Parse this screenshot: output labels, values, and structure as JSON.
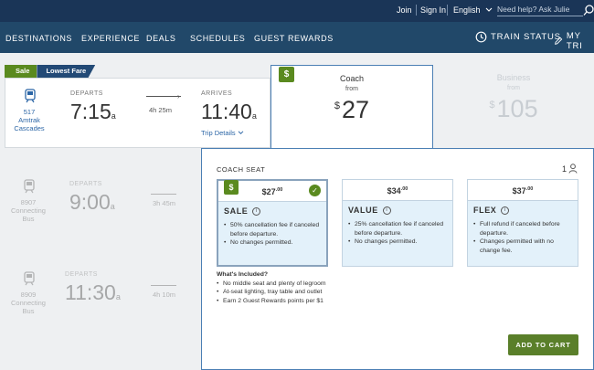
{
  "topbar": {
    "join": "Join",
    "sign_in": "Sign In",
    "language": "English",
    "help_placeholder": "Need help? Ask Julie"
  },
  "nav": {
    "items": [
      "DESTINATIONS",
      "EXPERIENCE",
      "DEALS",
      "SCHEDULES",
      "GUEST REWARDS"
    ],
    "train_status": "TRAIN STATUS",
    "my_trip": "MY TRI"
  },
  "trip1": {
    "tag_sale": "Sale",
    "tag_lowest": "Lowest Fare",
    "train_number": "517",
    "train_name": "Amtrak Cascades",
    "departs_label": "DEPARTS",
    "depart_time": "7:15",
    "depart_ampm": "a",
    "duration": "4h 25m",
    "arrives_label": "ARRIVES",
    "arrive_time": "11:40",
    "arrive_ampm": "a",
    "trip_details": "Trip Details"
  },
  "trip2": {
    "train_number": "8907",
    "train_name": "Connecting Bus",
    "departs_label": "DEPARTS",
    "depart_time": "9:00",
    "depart_ampm": "a",
    "duration": "3h 45m"
  },
  "trip3": {
    "train_number": "8909",
    "train_name": "Connecting Bus",
    "departs_label": "DEPARTS",
    "depart_time": "11:30",
    "depart_ampm": "a",
    "duration": "4h 10m"
  },
  "coach": {
    "badge": "$",
    "title": "Coach",
    "from": "from",
    "currency": "$",
    "price": "27"
  },
  "business": {
    "title": "Business",
    "from": "from",
    "currency": "$",
    "price": "105"
  },
  "panel": {
    "heading": "COACH SEAT",
    "passengers": "1",
    "fares": [
      {
        "price": "$27",
        "cents": ".00",
        "name": "SALE",
        "bullets": [
          "50% cancellation fee if canceled before departure.",
          "No changes permitted."
        ]
      },
      {
        "price": "$34",
        "cents": ".00",
        "name": "VALUE",
        "bullets": [
          "25% cancellation fee if canceled before departure.",
          "No changes permitted."
        ]
      },
      {
        "price": "$37",
        "cents": ".00",
        "name": "FLEX",
        "bullets": [
          "Full refund if canceled before departure.",
          "Changes permitted with no change fee."
        ]
      }
    ],
    "included_heading": "What's Included?",
    "included": [
      "No middle seat and plenty of legroom",
      "At-seat lighting, tray table and outlet",
      "Earn 2 Guest Rewards points per $1"
    ],
    "add_to_cart": "ADD TO CART"
  },
  "colors": {
    "topbar": "#1a3557",
    "navbar": "#214869",
    "green": "#5a8a1f",
    "link": "#2c66a6",
    "selected_border": "#4b7fb4"
  }
}
